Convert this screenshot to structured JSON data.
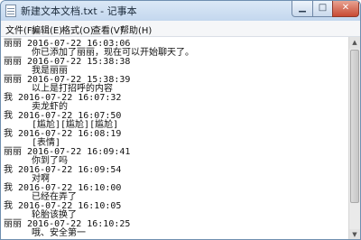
{
  "window": {
    "title": "新建文本文档.txt - 记事本",
    "min_glyph": "▁",
    "max_glyph": "□",
    "close_glyph": "✕"
  },
  "menu": [
    "文件(F)",
    "编辑(E)",
    "格式(O)",
    "查看(V)",
    "帮助(H)"
  ],
  "lines": [
    "丽丽 2016-07-22 16:03:06",
    "你已添加了丽丽，现在可以开始聊天了。",
    "丽丽 2016-07-22 15:38:38",
    "我是丽丽",
    "丽丽 2016-07-22 15:38:39",
    "以上是打招呼的内容",
    "我 2016-07-22 16:07:32",
    "卖龙虾的",
    "我 2016-07-22 16:07:50",
    "[尴尬][尴尬][尴尬]",
    "我 2016-07-22 16:08:19",
    "[表情]",
    "丽丽 2016-07-22 16:09:41",
    "你到了吗",
    "我 2016-07-22 16:09:54",
    "对啊",
    "我 2016-07-22 16:10:00",
    "已经在弄了",
    "我 2016-07-22 16:10:05",
    "轮胎该换了",
    "丽丽 2016-07-22 16:10:25",
    "哦、安全第一"
  ],
  "scrollbar": {
    "up_glyph": "▲",
    "down_glyph": "▼"
  }
}
